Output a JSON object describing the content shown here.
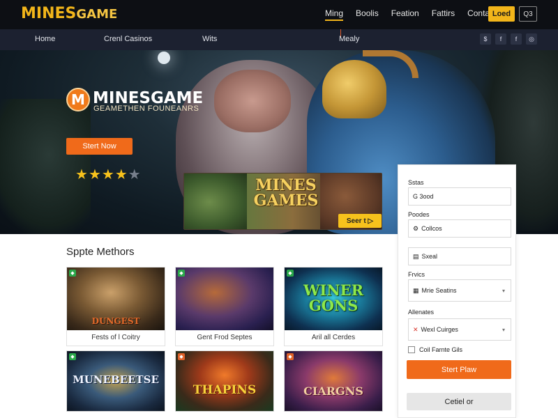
{
  "header": {
    "logo_main": "MINES",
    "logo_sub": "GAME",
    "nav": [
      "Ming",
      "Boolis",
      "Feation",
      "Fattirs",
      "Contacts"
    ],
    "load_label": "Loed",
    "search_label": "Q3"
  },
  "subnav": {
    "items": [
      "Home",
      "Crenl Casinos",
      "Wits",
      "Mealy"
    ],
    "socials": [
      "$",
      "f",
      "f",
      "◎"
    ]
  },
  "hero": {
    "brand_initial": "M",
    "brand_name": "MINESGAME",
    "tagline": "GEAMETHEN FOUNEANRS",
    "start_label": "Stert Now",
    "rating": 4,
    "rating_max": 5,
    "banner_title": "MINES GAMES",
    "banner_btn": "Seer t ▷"
  },
  "section_title": "Sppte Methors",
  "cards": [
    {
      "title_art": "DUNGEST",
      "caption": "Fests of l Coitry",
      "badge_color": "#2aa84a"
    },
    {
      "title_art": "",
      "caption": "Gent Frod Septes",
      "badge_color": "#2aa84a"
    },
    {
      "title_art": "WINER GONS",
      "caption": "Aril all Cerdes",
      "badge_color": "#2aa84a"
    },
    {
      "title_art": "MUNEBEETSE",
      "caption": "",
      "badge_color": "#2aa84a"
    },
    {
      "title_art": "THAPINS",
      "caption": "",
      "badge_color": "#e0622a"
    },
    {
      "title_art": "CIARGNS",
      "caption": "",
      "badge_color": "#e0622a"
    }
  ],
  "panel": {
    "label1": "Sstas",
    "field1": "G 3ood",
    "label2": "Poodes",
    "field2": "Collcos",
    "field3": "Sxeal",
    "label3": "Frvics",
    "field4": "Mrie Seatins",
    "label4": "Allenates",
    "field5": "Wexl Cuirges",
    "checkbox": "Coil Farnte Gils",
    "primary": "Stert Plaw",
    "secondary": "Cetiel or"
  },
  "colors": {
    "accent_orange": "#f06a1a",
    "accent_gold": "#f2b51a",
    "nav_dark": "#0d0f14"
  }
}
